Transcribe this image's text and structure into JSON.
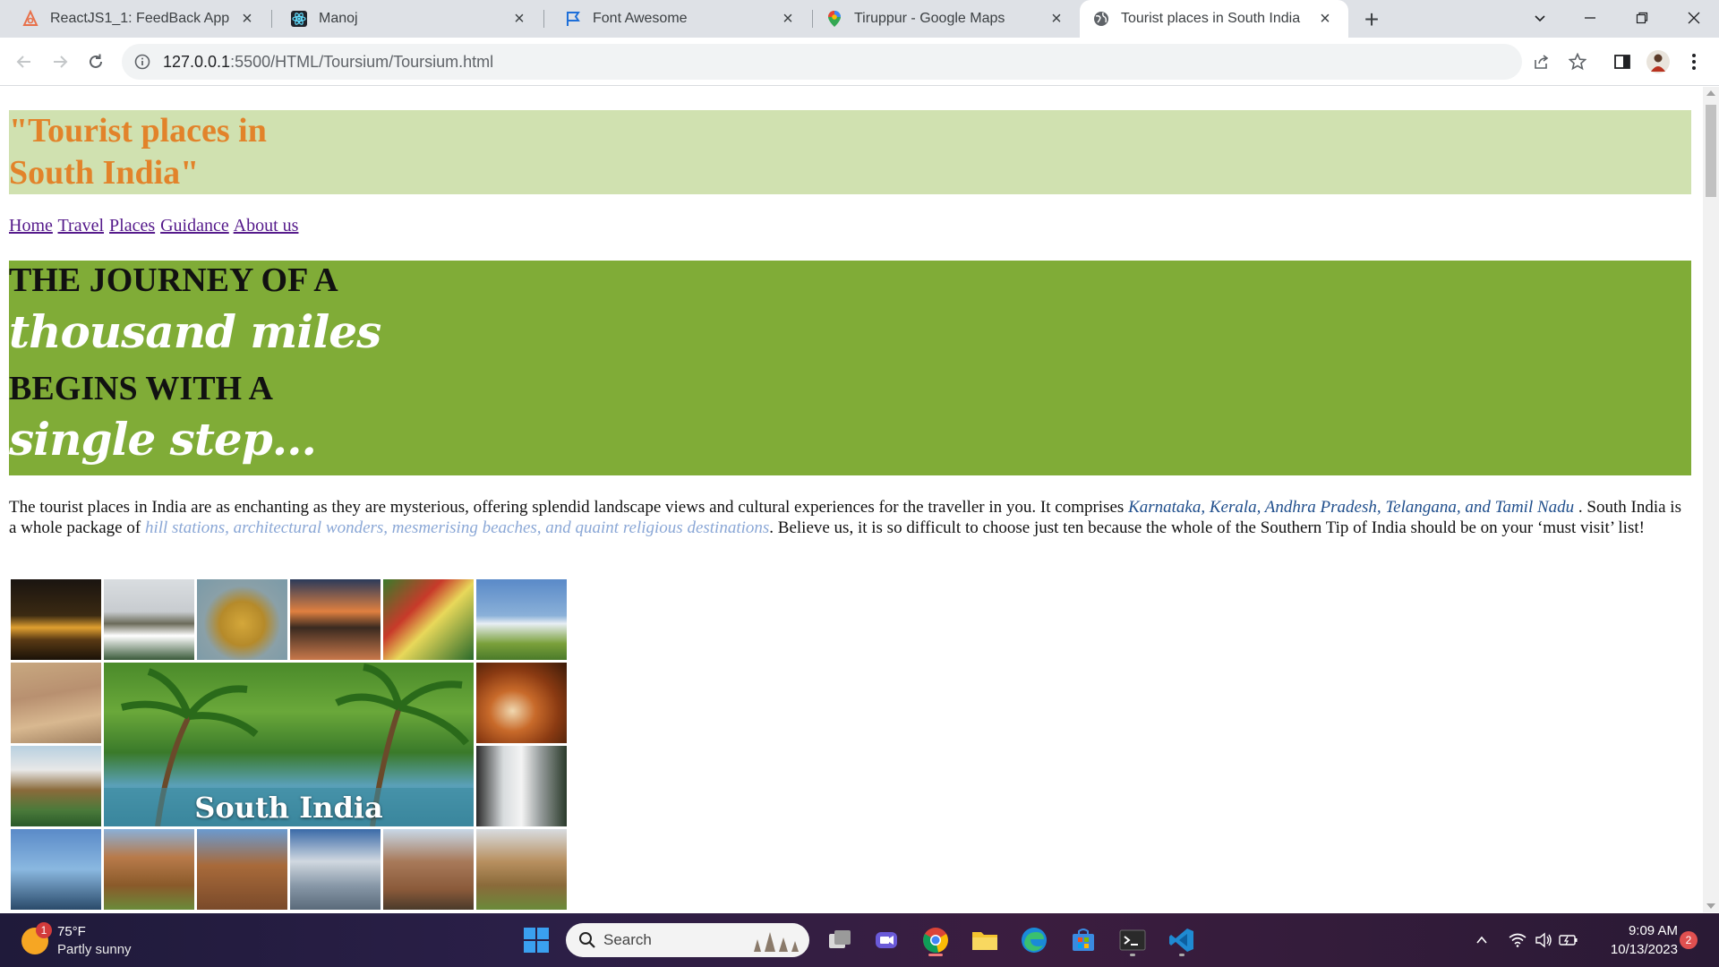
{
  "browser": {
    "tabs": [
      {
        "title": "ReactJS1_1: FeedBack App",
        "icon": "react-flame-icon"
      },
      {
        "title": "Manoj",
        "icon": "react-atom-icon"
      },
      {
        "title": "Font Awesome",
        "icon": "flag-icon"
      },
      {
        "title": "Tiruppur - Google Maps",
        "icon": "maps-pin-icon"
      },
      {
        "title": "Tourist places in South India",
        "icon": "globe-icon"
      }
    ],
    "active_tab": 4,
    "url_host": "127.0.0.1",
    "url_rest": ":5500/HTML/Toursium/Toursium.html"
  },
  "page": {
    "title_line1": "\"Tourist places in",
    "title_line2": "South India\"",
    "nav": [
      "Home",
      "Travel",
      "Places",
      "Guidance",
      "About us"
    ],
    "hero": {
      "line1": "THE JOURNEY OF A",
      "line2": "thousand miles",
      "line3": "BEGINS WITH A",
      "line4": "single step..."
    },
    "desc": {
      "part1": "The tourist places in India are as enchanting as they are mysterious, offering splendid landscape views and cultural experiences for the traveller in you. It comprises ",
      "states": "Karnataka, Kerala, Andhra Pradesh, Telangana, and Tamil Nadu",
      "part2": " . South India is a whole package of ",
      "kinds": "hill stations, architectural wonders, mesmerising beaches, and quaint religious destinations",
      "part3": ". Believe us, it is so difficult to choose just ten because the whole of the Southern Tip of India should be on your ‘must visit’ list!"
    },
    "collage_caption": "South India"
  },
  "taskbar": {
    "weather_temp": "75°F",
    "weather_cond": "Partly sunny",
    "weather_badge": "1",
    "search_label": "Search",
    "time": "9:09 AM",
    "date": "10/13/2023",
    "notifications": "2"
  },
  "colors": {
    "header_bg": "#d0e1b0",
    "title": "#e2832a",
    "hero_bg": "#80ac37",
    "link": "#551a8b"
  }
}
